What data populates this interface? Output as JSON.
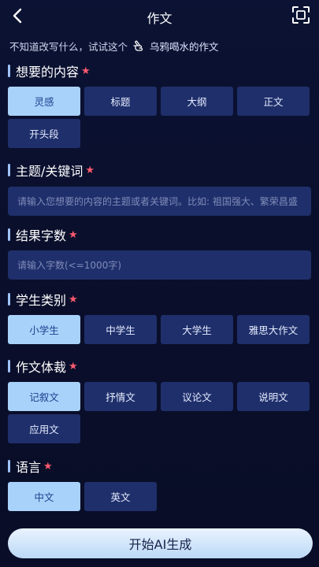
{
  "header": {
    "title": "作文"
  },
  "hint": {
    "prefix": "不知道改写什么，试试这个",
    "link": "乌鸦喝水的作文"
  },
  "sections": {
    "content": {
      "title": "想要的内容",
      "options": [
        "灵感",
        "标题",
        "大纲",
        "正文",
        "开头段"
      ]
    },
    "topic": {
      "title": "主题/关键词",
      "placeholder": "请输入您想要的内容的主题或者关键词。比如: 祖国强大、繁荣昌盛"
    },
    "wordcount": {
      "title": "结果字数",
      "placeholder": "请输入字数(<=1000字)"
    },
    "student": {
      "title": "学生类别",
      "options": [
        "小学生",
        "中学生",
        "大学生",
        "雅思大作文"
      ]
    },
    "genre": {
      "title": "作文体裁",
      "options": [
        "记叙文",
        "抒情文",
        "议论文",
        "说明文",
        "应用文"
      ]
    },
    "language": {
      "title": "语言",
      "options": [
        "中文",
        "英文"
      ]
    }
  },
  "cta": {
    "label": "开始AI生成"
  },
  "colors": {
    "accent": "#a9d2fb",
    "star": "#ff5b6e",
    "option_bg": "#1f2f6b"
  }
}
